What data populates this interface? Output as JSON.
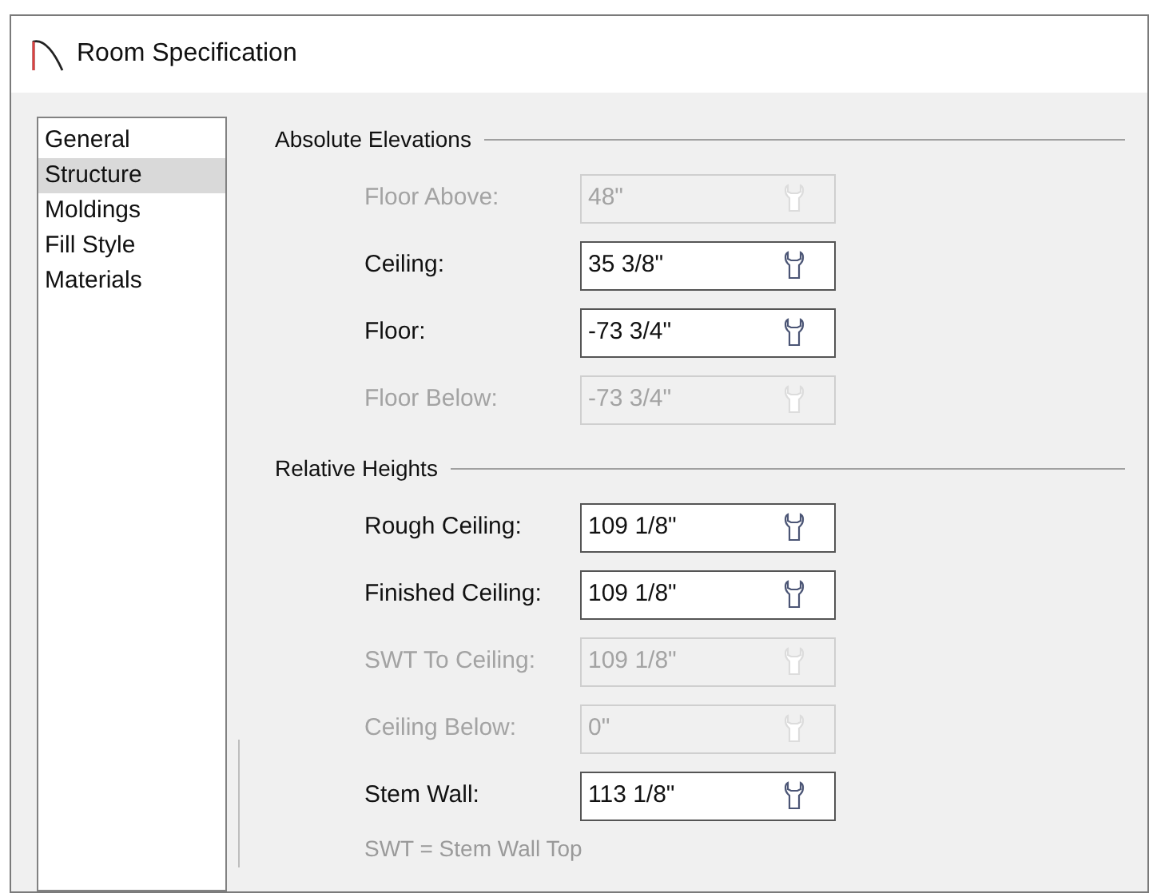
{
  "window": {
    "title": "Room Specification"
  },
  "sidebar": {
    "items": [
      {
        "label": "General",
        "selected": false
      },
      {
        "label": "Structure",
        "selected": true
      },
      {
        "label": "Moldings",
        "selected": false
      },
      {
        "label": "Fill Style",
        "selected": false
      },
      {
        "label": "Materials",
        "selected": false
      }
    ]
  },
  "sections": [
    {
      "title": "Absolute Elevations",
      "fields": [
        {
          "label": "Floor Above:",
          "value": "48\"",
          "disabled": true
        },
        {
          "label": "Ceiling:",
          "value": "35 3/8\"",
          "disabled": false
        },
        {
          "label": "Floor:",
          "value": "-73 3/4\"",
          "disabled": false
        },
        {
          "label": "Floor Below:",
          "value": "-73 3/4\"",
          "disabled": true
        }
      ]
    },
    {
      "title": "Relative Heights",
      "fields": [
        {
          "label": "Rough Ceiling:",
          "value": "109 1/8\"",
          "disabled": false
        },
        {
          "label": "Finished Ceiling:",
          "value": "109 1/8\"",
          "disabled": false
        },
        {
          "label": "SWT To Ceiling:",
          "value": "109 1/8\"",
          "disabled": true
        },
        {
          "label": "Ceiling Below:",
          "value": "0\"",
          "disabled": true
        },
        {
          "label": "Stem Wall:",
          "value": "113 1/8\"",
          "disabled": false
        }
      ],
      "note": "SWT = Stem Wall Top"
    }
  ]
}
